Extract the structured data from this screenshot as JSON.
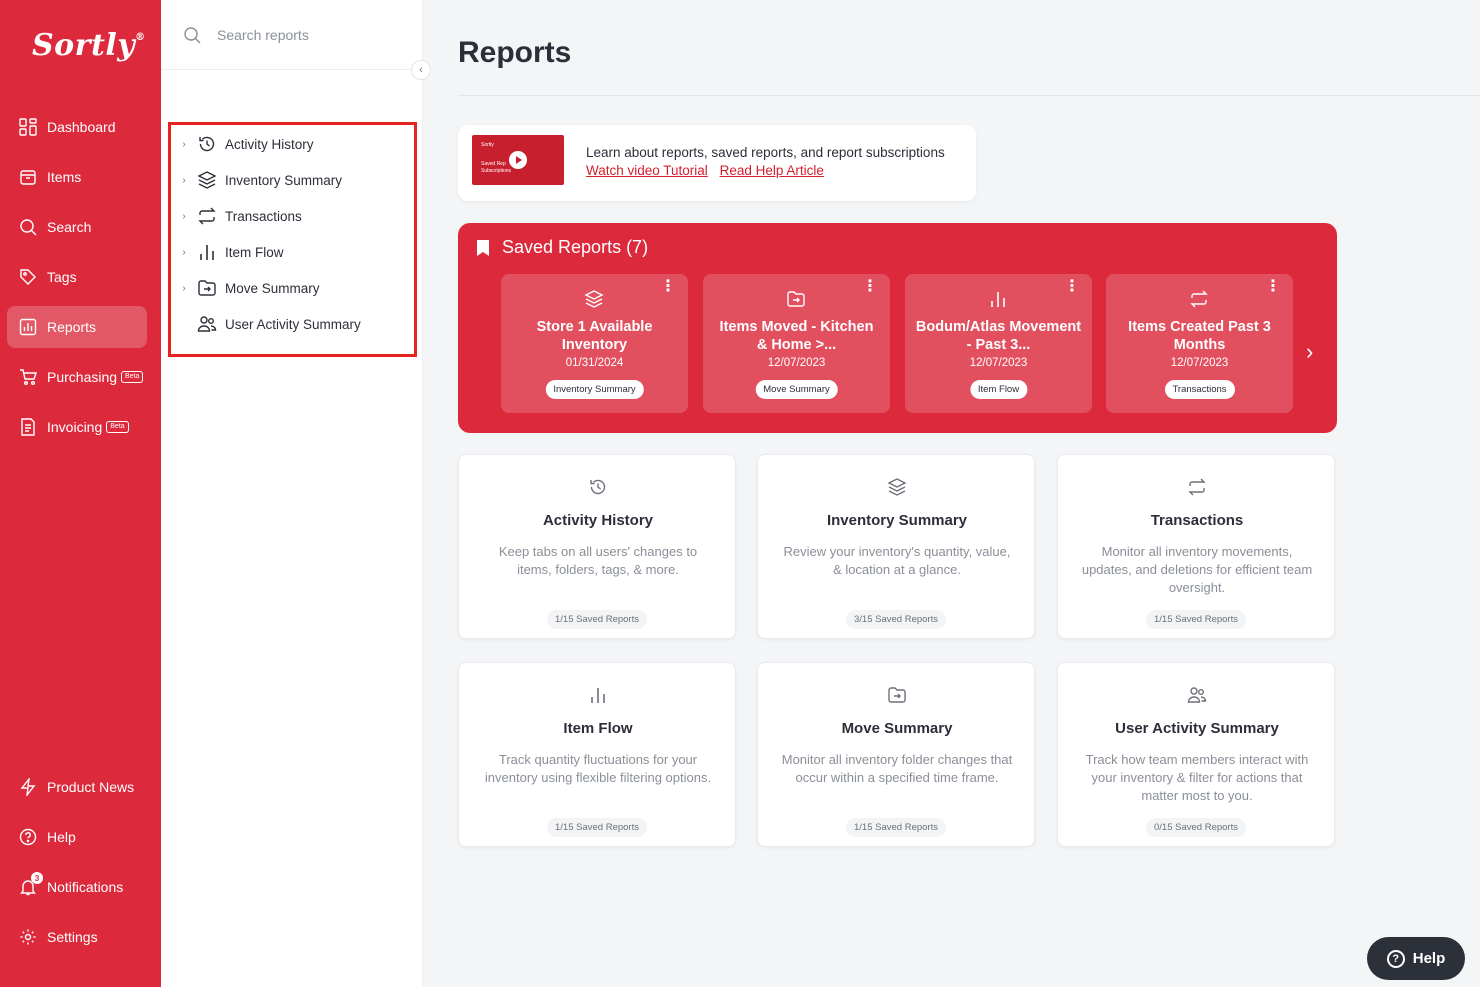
{
  "brand": {
    "logo_text": "Sortly",
    "accent": "#dc2a3c"
  },
  "sidebar": {
    "items": [
      {
        "label": "Dashboard",
        "icon": "dashboard-icon"
      },
      {
        "label": "Items",
        "icon": "items-icon"
      },
      {
        "label": "Search",
        "icon": "search-icon"
      },
      {
        "label": "Tags",
        "icon": "tag-icon"
      },
      {
        "label": "Reports",
        "icon": "reports-icon",
        "active": true
      },
      {
        "label": "Purchasing",
        "icon": "cart-icon",
        "badge": "Beta"
      },
      {
        "label": "Invoicing",
        "icon": "invoice-icon",
        "badge": "Beta"
      }
    ],
    "bottom": [
      {
        "label": "Product News",
        "icon": "bolt-icon"
      },
      {
        "label": "Help",
        "icon": "help-icon"
      },
      {
        "label": "Notifications",
        "icon": "bell-icon",
        "count": "3"
      },
      {
        "label": "Settings",
        "icon": "gear-icon"
      }
    ]
  },
  "panel": {
    "search_placeholder": "Search reports",
    "tree": [
      {
        "label": "Activity History",
        "icon": "history-icon",
        "expandable": true
      },
      {
        "label": "Inventory Summary",
        "icon": "layers-icon",
        "expandable": true
      },
      {
        "label": "Transactions",
        "icon": "swap-icon",
        "expandable": true
      },
      {
        "label": "Item Flow",
        "icon": "bars-icon",
        "expandable": true
      },
      {
        "label": "Move Summary",
        "icon": "folder-move-icon",
        "expandable": true
      },
      {
        "label": "User Activity Summary",
        "icon": "users-icon",
        "expandable": false
      }
    ]
  },
  "main": {
    "title": "Reports",
    "tutorial": {
      "text": "Learn about reports, saved reports, and report subscriptions",
      "link1": "Watch video Tutorial",
      "link2": "Read Help Article",
      "thumb_lines": [
        "Sortly",
        "Saved Rep",
        "Subscriptions"
      ]
    },
    "saved": {
      "title": "Saved Reports (7)",
      "cards": [
        {
          "title": "Store 1 Available Inventory",
          "date": "01/31/2024",
          "tag": "Inventory Summary",
          "icon": "layers-icon"
        },
        {
          "title": "Items Moved - Kitchen & Home >...",
          "date": "12/07/2023",
          "tag": "Move Summary",
          "icon": "folder-move-icon"
        },
        {
          "title": "Bodum/Atlas Movement - Past 3...",
          "date": "12/07/2023",
          "tag": "Item Flow",
          "icon": "bars-icon"
        },
        {
          "title": "Items Created Past 3 Months",
          "date": "12/07/2023",
          "tag": "Transactions",
          "icon": "swap-icon"
        }
      ]
    },
    "report_cards": [
      {
        "title": "Activity History",
        "desc": "Keep tabs on all users' changes to items, folders, tags, & more.",
        "count": "1/15 Saved Reports",
        "icon": "history-icon"
      },
      {
        "title": "Inventory Summary",
        "desc": "Review your inventory's quantity, value, & location at a glance.",
        "count": "3/15 Saved Reports",
        "icon": "layers-icon"
      },
      {
        "title": "Transactions",
        "desc": "Monitor all inventory movements, updates, and deletions for efficient team oversight.",
        "count": "1/15 Saved Reports",
        "icon": "swap-icon"
      },
      {
        "title": "Item Flow",
        "desc": "Track quantity fluctuations for your inventory using flexible filtering options.",
        "count": "1/15 Saved Reports",
        "icon": "bars-icon"
      },
      {
        "title": "Move Summary",
        "desc": "Monitor all inventory folder changes that occur within a specified time frame.",
        "count": "1/15 Saved Reports",
        "icon": "folder-move-icon"
      },
      {
        "title": "User Activity Summary",
        "desc": "Track how team members interact with your inventory & filter for actions that matter most to you.",
        "count": "0/15 Saved Reports",
        "icon": "users-icon"
      }
    ]
  },
  "help_button": "Help"
}
